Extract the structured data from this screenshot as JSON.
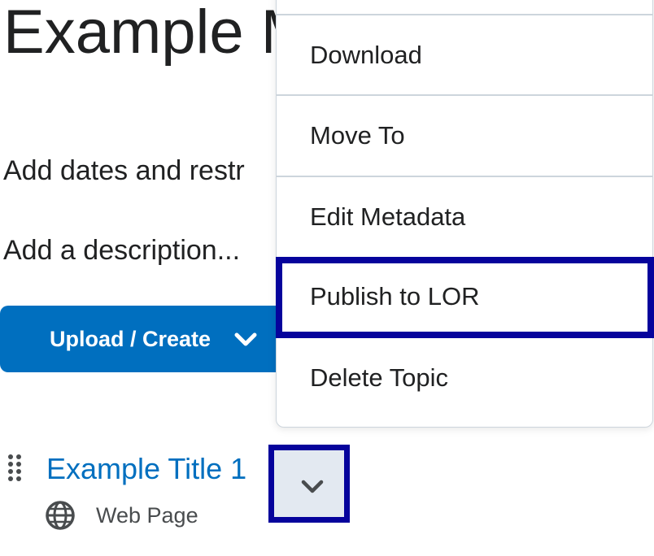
{
  "page": {
    "module_title": "Example M",
    "add_dates_link": "Add dates and restr",
    "add_description_link": "Add a description...",
    "upload_button_label": "Upload / Create"
  },
  "topic": {
    "title": "Example Title 1",
    "type": "Web Page"
  },
  "menu": {
    "items": [
      {
        "label": "Download"
      },
      {
        "label": "Move To"
      },
      {
        "label": "Edit Metadata"
      },
      {
        "label": "Publish to LOR"
      },
      {
        "label": "Delete Topic"
      }
    ]
  },
  "colors": {
    "accent": "#006fbf",
    "highlight_border": "#06039c",
    "text": "#202122"
  }
}
